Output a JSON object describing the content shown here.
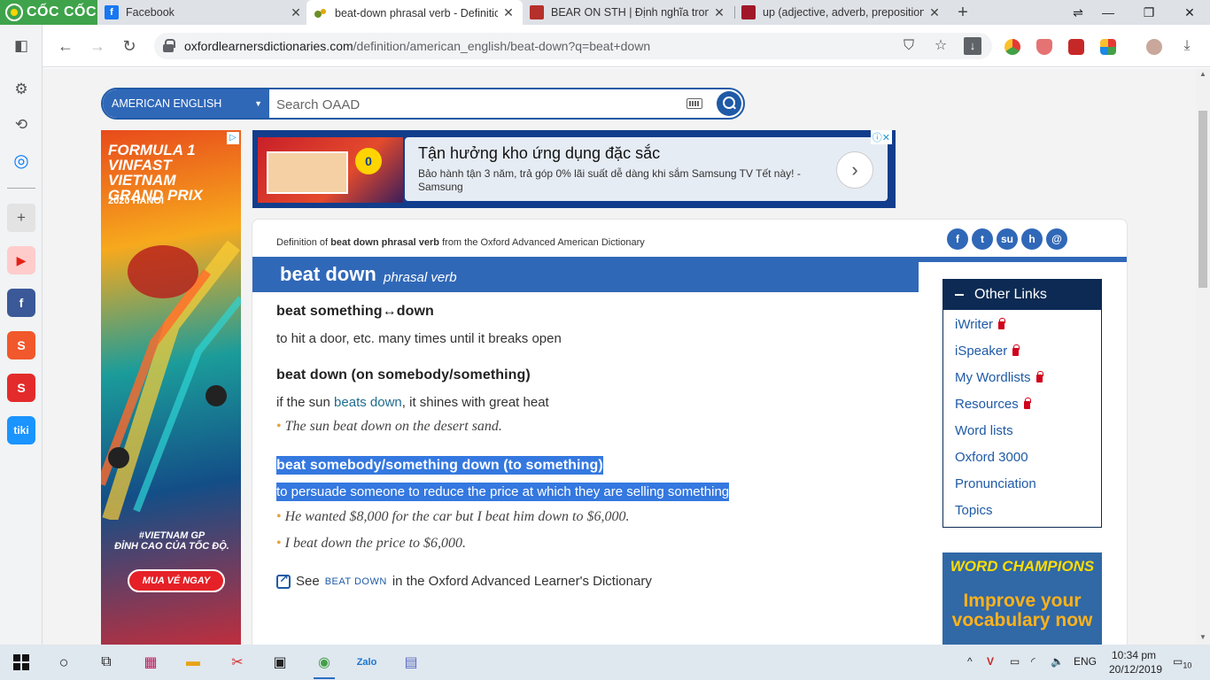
{
  "browser": {
    "brand": "CỐC CỐC",
    "tabs": [
      {
        "title": "Facebook",
        "favicon_color": "#1877f2",
        "favicon_glyph": "f",
        "active": false
      },
      {
        "title": "beat-down phrasal verb - Definitio",
        "favicon_color": "#6b8e23",
        "favicon_glyph": "",
        "active": true
      },
      {
        "title": "BEAR ON STH | Định nghĩa trong T",
        "favicon_color": "#b5302a",
        "favicon_glyph": "",
        "active": false
      },
      {
        "title": "up (adjective, adverb, preposition)",
        "favicon_color": "#a01828",
        "favicon_glyph": "",
        "active": false
      }
    ],
    "url_host": "oxfordlearnersdictionaries.com",
    "url_path": "/definition/american_english/beat-down?q=beat+down"
  },
  "page": {
    "search": {
      "language": "AMERICAN ENGLISH",
      "placeholder": "Search OAAD"
    },
    "ad_left": {
      "headline_lines": [
        "FORMULA 1",
        "VINFAST",
        "VIETNAM",
        "GRAND PRIX"
      ],
      "subline": "2020 HANOI",
      "tagline_lines": [
        "#VIETNAM GP",
        "ĐỈNH CAO CỦA TỐC ĐỘ."
      ],
      "cta": "MUA VÉ NGAY"
    },
    "ad_top": {
      "headline": "Tận hưởng kho ứng dụng đặc sắc",
      "body": "Bảo hành tận 3 năm, trả góp 0% lãi suất dễ dàng khi sắm Samsung TV Tết này! - Samsung",
      "badge": "0"
    },
    "entry": {
      "crumb_prefix": "Definition of",
      "crumb_term": "beat down phrasal verb",
      "crumb_suffix": "from the Oxford Advanced American Dictionary",
      "social": [
        "f",
        "t",
        "su",
        "h",
        "@"
      ],
      "headword": "beat down",
      "pos": "phrasal verb",
      "senses": [
        {
          "head": "beat something↔down",
          "definition": "to hit a door, etc. many times until it breaks open",
          "examples": []
        },
        {
          "head": "beat down (on somebody/something)",
          "definition_pre": "if the sun",
          "definition_link": "beats down",
          "definition_post": ", it shines with great heat",
          "examples": [
            "The sun beat down on the desert sand."
          ]
        },
        {
          "head": "beat somebody/something down (to something)",
          "definition": "to persuade someone to reduce the price at which they are selling something",
          "examples": [
            "He wanted $8,000 for the car but I beat him down to $6,000.",
            "I beat down the price to $6,000."
          ]
        }
      ],
      "see_prefix": "See",
      "see_term": "BEAT DOWN",
      "see_suffix": "in the Oxford Advanced Learner's Dictionary"
    },
    "other_links": {
      "title": "Other Links",
      "items": [
        {
          "label": "iWriter",
          "locked": true
        },
        {
          "label": "iSpeaker",
          "locked": true
        },
        {
          "label": "My Wordlists",
          "locked": true
        },
        {
          "label": "Resources",
          "locked": true
        },
        {
          "label": "Word lists",
          "locked": false
        },
        {
          "label": "Oxford 3000",
          "locked": false
        },
        {
          "label": "Pronunciation",
          "locked": false
        },
        {
          "label": "Topics",
          "locked": false
        }
      ]
    },
    "wc_ad": {
      "logo": "WORD CHAMPIONS",
      "tagline": "Improve your vocabulary now"
    }
  },
  "taskbar": {
    "language": "ENG",
    "time": "10:34 pm",
    "date": "20/12/2019",
    "notifications": "10"
  },
  "colors": {
    "accent": "#3068b8",
    "dark_navy": "#0c2a53",
    "highlight": "#3478e0",
    "bullet": "#e6a23c"
  }
}
